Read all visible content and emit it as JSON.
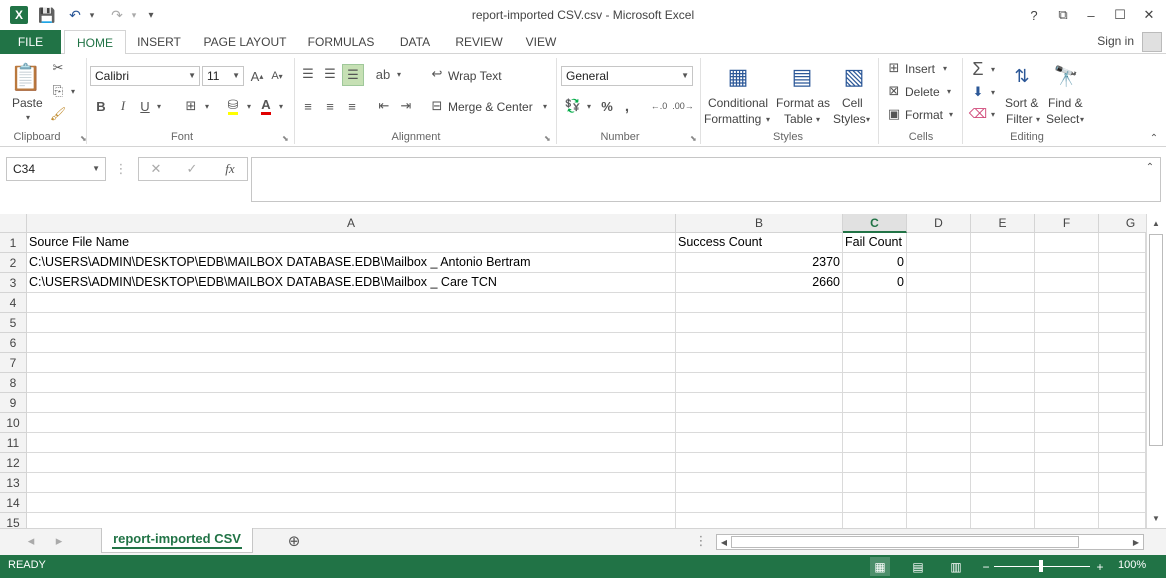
{
  "window": {
    "title": "report-imported CSV.csv - Microsoft Excel",
    "help": "?",
    "restore_ribbon": "⧉",
    "minimize": "–",
    "maximize": "☐",
    "close": "✕"
  },
  "qat": {
    "logo": "X",
    "save": "💾",
    "undo": "↶",
    "redo": "↷",
    "customize": "▾"
  },
  "tabs": {
    "file": "FILE",
    "items": [
      "HOME",
      "INSERT",
      "PAGE LAYOUT",
      "FORMULAS",
      "DATA",
      "REVIEW",
      "VIEW"
    ],
    "active": "HOME",
    "signin": "Sign in"
  },
  "ribbon": {
    "clipboard": {
      "paste": "Paste",
      "label": "Clipboard"
    },
    "font": {
      "name": "Calibri",
      "size": "11",
      "grow": "A",
      "shrink": "A",
      "bold": "B",
      "italic": "I",
      "underline": "U",
      "label": "Font"
    },
    "alignment": {
      "wrap_text": "Wrap Text",
      "merge_center": "Merge & Center",
      "label": "Alignment"
    },
    "number": {
      "format": "General",
      "percent": "%",
      "comma": ",",
      "label": "Number"
    },
    "styles": {
      "conditional_formatting": [
        "Conditional",
        "Formatting"
      ],
      "format_as_table": [
        "Format as",
        "Table"
      ],
      "cell_styles": [
        "Cell",
        "Styles"
      ],
      "label": "Styles"
    },
    "cells": {
      "insert": "Insert",
      "delete": "Delete",
      "format": "Format",
      "label": "Cells"
    },
    "editing": {
      "autosum": "Σ",
      "sort_filter": [
        "Sort &",
        "Filter"
      ],
      "find_select": [
        "Find &",
        "Select"
      ],
      "label": "Editing"
    }
  },
  "formula_bar": {
    "name_box": "C34",
    "cancel": "✕",
    "enter": "✓",
    "fx": "fx",
    "value": ""
  },
  "grid": {
    "columns": [
      "A",
      "B",
      "C",
      "D",
      "E",
      "F",
      "G"
    ],
    "selected_column": "C",
    "rows": [
      "1",
      "2",
      "3",
      "4",
      "5",
      "6",
      "7",
      "8",
      "9",
      "10",
      "11",
      "12",
      "13",
      "14",
      "15"
    ],
    "cells": {
      "A1": "Source File Name",
      "B1": "Success Count",
      "C1": "Fail Count",
      "A2": "C:\\USERS\\ADMIN\\DESKTOP\\EDB\\MAILBOX DATABASE.EDB\\Mailbox _ Antonio Bertram",
      "B2": "2370",
      "C2": "0",
      "A3": "C:\\USERS\\ADMIN\\DESKTOP\\EDB\\MAILBOX DATABASE.EDB\\Mailbox _ Care TCN",
      "B3": "2660",
      "C3": "0"
    }
  },
  "sheets": {
    "prev": "◂",
    "next": "▸",
    "active": "report-imported CSV",
    "add": "⊕"
  },
  "status": {
    "mode": "READY",
    "zoom_out": "−",
    "zoom_in": "+",
    "zoom": "100%"
  },
  "colors": {
    "accent": "#217346",
    "header_bg": "#f3f3f3",
    "gridline": "#dadada"
  }
}
